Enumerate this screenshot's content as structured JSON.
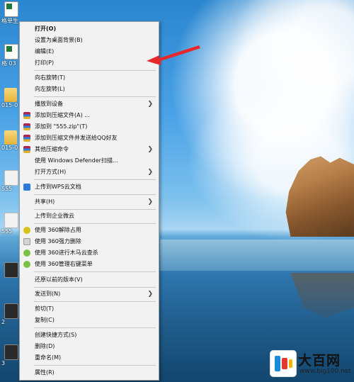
{
  "desktop": {
    "icons": [
      {
        "label": "格单生",
        "type": "xls"
      },
      {
        "label": "格 03",
        "type": "xls"
      },
      {
        "label": "015-0",
        "type": "folder"
      },
      {
        "label": "015-0",
        "type": "folder"
      },
      {
        "label": "555",
        "type": "doc"
      },
      {
        "label": "555",
        "type": "doc"
      },
      {
        "label": "",
        "type": "dark"
      },
      {
        "label": "2",
        "type": "dark"
      },
      {
        "label": "3",
        "type": "dark"
      }
    ]
  },
  "context_menu": {
    "items": [
      {
        "label": "打开(O)",
        "bold": true,
        "icon": "",
        "submenu": false
      },
      {
        "label": "设置为桌面背景(B)",
        "icon": "",
        "submenu": false
      },
      {
        "label": "编辑(E)",
        "icon": "",
        "submenu": false
      },
      {
        "label": "打印(P)",
        "icon": "",
        "submenu": false
      },
      {
        "label": "向右旋转(T)",
        "icon": "",
        "submenu": false
      },
      {
        "label": "向左旋转(L)",
        "icon": "",
        "submenu": false
      },
      {
        "label": "播放到设备",
        "icon": "",
        "submenu": true
      },
      {
        "label": "添加到压缩文件(A) ...",
        "icon": "winrar-icon",
        "submenu": false
      },
      {
        "label": "添加到 \"555.zip\"(T)",
        "icon": "winrar-icon",
        "submenu": false
      },
      {
        "label": "添加到压缩文件并发送给QQ好友",
        "icon": "winrar-icon",
        "submenu": false
      },
      {
        "label": "其他压缩命令",
        "icon": "winrar-icon",
        "submenu": true
      },
      {
        "label": "使用 Windows Defender扫描...",
        "icon": "",
        "submenu": false
      },
      {
        "label": "打开方式(H)",
        "icon": "",
        "submenu": true
      },
      {
        "label": "上传到WPS云文档",
        "icon": "wps-cloud-icon",
        "submenu": false
      },
      {
        "label": "共享(H)",
        "icon": "",
        "submenu": true
      },
      {
        "label": "上传到企业微云",
        "icon": "",
        "submenu": false
      },
      {
        "label": "使用 360解除占用",
        "icon": "360-unlock-icon",
        "submenu": false
      },
      {
        "label": "使用 360强力删除",
        "icon": "360-shredder-icon",
        "submenu": false
      },
      {
        "label": "使用 360进行木马云查杀",
        "icon": "360-scan-icon",
        "submenu": false
      },
      {
        "label": "使用 360管理右键菜单",
        "icon": "360-menu-icon",
        "submenu": false
      },
      {
        "label": "还原以前的版本(V)",
        "icon": "",
        "submenu": false
      },
      {
        "label": "发送到(N)",
        "icon": "",
        "submenu": true
      },
      {
        "label": "剪切(T)",
        "icon": "",
        "submenu": false
      },
      {
        "label": "复制(C)",
        "icon": "",
        "submenu": false
      },
      {
        "label": "创建快捷方式(S)",
        "icon": "",
        "submenu": false
      },
      {
        "label": "删除(D)",
        "icon": "",
        "submenu": false
      },
      {
        "label": "重命名(M)",
        "icon": "",
        "submenu": false
      },
      {
        "label": "属性(R)",
        "icon": "",
        "submenu": false
      }
    ]
  },
  "annotation": {
    "type": "red-arrow",
    "points_to": "打印(P)",
    "color": "#e8272b"
  },
  "watermark": {
    "title": "大百网",
    "url": "www.big100.net"
  }
}
